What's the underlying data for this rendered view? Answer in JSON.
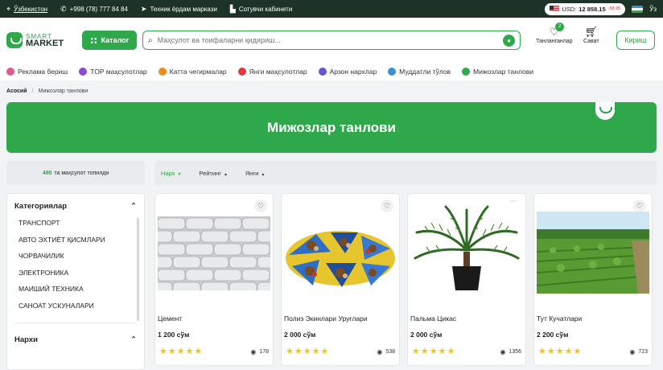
{
  "topbar": {
    "location": "Ўзбекистон",
    "phone": "+998 (78) 777 84 84",
    "support": "Техник ёрдам маркази",
    "seller_cabinet": "Сотувчи кабинети",
    "currency": "USD:",
    "rate": "12 858.15",
    "rate_delta": "-58.95",
    "language": "Ўз"
  },
  "header": {
    "logo_top": "SMART",
    "logo_bottom": "MARKET",
    "catalog_label": "Каталог",
    "search_placeholder": "Маҳсулот ва тоифаларни қидириш...",
    "favorites_label": "Танланганлар",
    "favorites_count": "2",
    "cart_label": "Сават",
    "login_label": "Кириш"
  },
  "promos": [
    {
      "label": "Реклама бериш",
      "color": "#e25a8f"
    },
    {
      "label": "TOP маҳсулотлар",
      "color": "#8c4ad6"
    },
    {
      "label": "Катта чегирмалар",
      "color": "#f08a1a"
    },
    {
      "label": "Янги маҳсулотлар",
      "color": "#e23a3a"
    },
    {
      "label": "Арзон нархлар",
      "color": "#6a52d9"
    },
    {
      "label": "Муддатли тўлов",
      "color": "#3a8fd6"
    },
    {
      "label": "Мижозлар танлови",
      "color": "#2ea84a"
    }
  ],
  "breadcrumb": {
    "home": "Асосий",
    "separator": "/",
    "current": "Мижозлар танлови"
  },
  "banner": {
    "title": "Мижозлар танлови"
  },
  "results": {
    "count": "490",
    "text": "та маҳсулот топилди"
  },
  "sort": {
    "price": "Нарх",
    "rating": "Рейтинг",
    "new": "Янги"
  },
  "sidebar": {
    "categories_title": "Категориялар",
    "categories": [
      "ТРАНСПОРТ",
      "АВТО ЭХТИЁТ ҚИСМЛАРИ",
      "ЧОРВАЧИЛИК",
      "ЭЛЕКТРОНИКА",
      "МАИШИЙ ТЕХНИКА",
      "САНОАТ УСКУНАЛАРИ"
    ],
    "price_title": "Нархи"
  },
  "products": [
    {
      "name": "Цемент",
      "price": "1 200 сўм",
      "stars": "★★★★★",
      "views": "178"
    },
    {
      "name": "Полиз Экинлари Уруғлари",
      "price": "2 000 сўм",
      "stars": "★★★★★",
      "views": "538"
    },
    {
      "name": "Пальма Цикас",
      "price": "2 000 сўм",
      "stars": "★★★★★",
      "views": "1356"
    },
    {
      "name": "Тут Кучатлари",
      "price": "2 200 сўм",
      "stars": "★★★★★",
      "views": "723"
    }
  ]
}
